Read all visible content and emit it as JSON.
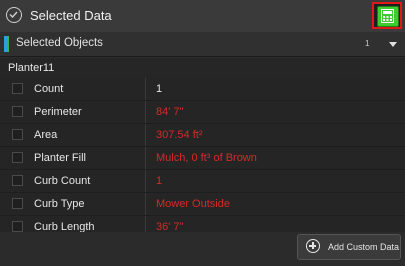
{
  "header": {
    "title": "Selected Data",
    "calculator_icon": "calculator-icon"
  },
  "selected_objects": {
    "label": "Selected Objects",
    "count": "1"
  },
  "object": {
    "name": "Planter11"
  },
  "properties": [
    {
      "label": "Count",
      "value": "1"
    },
    {
      "label": "Perimeter",
      "value": "84' 7\""
    },
    {
      "label": "Area",
      "value": "307.54 ft²"
    },
    {
      "label": "Planter Fill",
      "value": "Mulch, 0 ft³ of Brown"
    },
    {
      "label": "Curb Count",
      "value": "1"
    },
    {
      "label": "Curb Type",
      "value": "Mower Outside"
    },
    {
      "label": "Curb Length",
      "value": "36' 7\""
    }
  ],
  "footer": {
    "add_label": "Add Custom Data"
  },
  "colors": {
    "accent_red": "#d42a2a",
    "calc_green": "#3ecb2f",
    "highlight_border": "#e01818"
  }
}
